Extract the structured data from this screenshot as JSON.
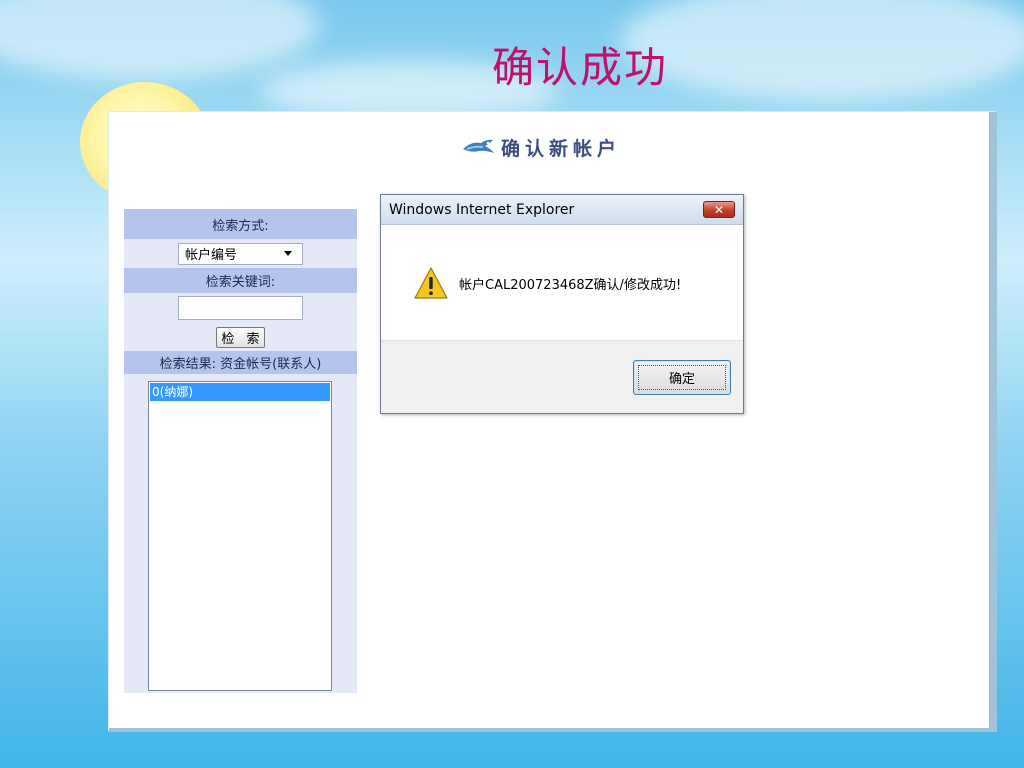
{
  "slide": {
    "title": "确认成功"
  },
  "page": {
    "header_title": "确认新帐户"
  },
  "sidebar": {
    "search_method_label": "检索方式:",
    "search_method_value": "帐户编号",
    "keyword_label": "检索关键词:",
    "keyword_value": "",
    "search_button": "检 索",
    "result_header": "检索结果: 资金帐号(联系人)",
    "results": [
      "0(纳娜)"
    ]
  },
  "dialog": {
    "title": "Windows Internet Explorer",
    "close_label": "✕",
    "message": "帐户CAL200723468Z确认/修改成功!",
    "ok_label": "确定"
  },
  "icons": {
    "header_logo": "bird-logo-icon",
    "warning": "warning-icon",
    "dropdown": "chevron-down-icon"
  }
}
